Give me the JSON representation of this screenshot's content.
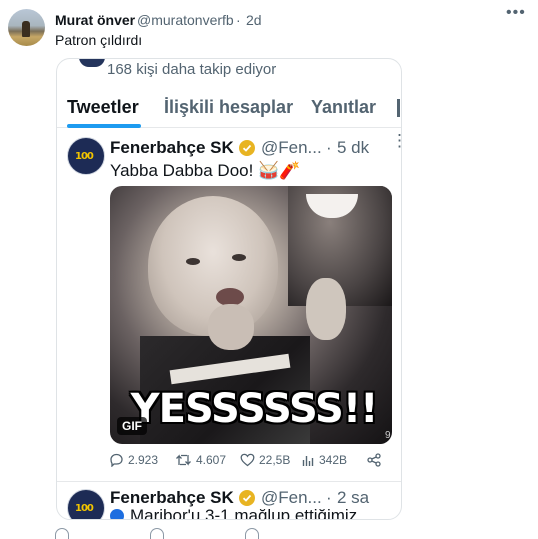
{
  "post": {
    "author_name": "Murat önver",
    "author_handle": "@muratonverfb",
    "separator": "·",
    "time": "2d",
    "more_icon": "ellipsis-icon",
    "text": "Patron çıldırdı"
  },
  "screenshot": {
    "followers_text": "168 kişi daha takip ediyor",
    "tabs": [
      {
        "label": "Tweetler",
        "active": true
      },
      {
        "label": "İlişkili hesaplar",
        "active": false
      },
      {
        "label": "Yanıtlar",
        "active": false
      }
    ],
    "tweets": [
      {
        "author_name": "Fenerbahçe SK",
        "handle": "@Fen...",
        "separator": "·",
        "time": "5 dk",
        "text": "Yabba Dabba Doo! 🥁🧨",
        "avatar_text": "100",
        "gif": {
          "caption": "YESSSSSS!!",
          "tag": "GIF",
          "corner_number": "9"
        },
        "stats": {
          "replies": "2.923",
          "retweets": "4.607",
          "likes": "22,5B",
          "views": "342B"
        }
      },
      {
        "author_name": "Fenerbahçe SK",
        "handle": "@Fen...",
        "separator": "·",
        "time": "2 sa",
        "avatar_text": "100",
        "text": "Maribor'u 3-1 mağlup ettiğimiz"
      }
    ]
  },
  "colors": {
    "accent": "#1d9bf0",
    "verified_badge": "#e8b422",
    "secondary_text": "#536471",
    "fb_navy": "#1d2b55"
  }
}
